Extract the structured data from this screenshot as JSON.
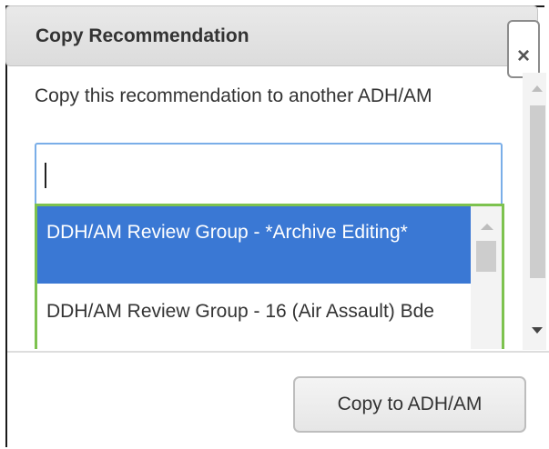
{
  "dialog": {
    "title": "Copy Recommendation",
    "close_glyph": "×",
    "prompt": "Copy this recommendation to another ADH/AM"
  },
  "search": {
    "value": "",
    "placeholder": ""
  },
  "dropdown": {
    "options": [
      {
        "label": "DDH/AM Review Group - *Archive Editing*",
        "selected": true
      },
      {
        "label": "DDH/AM Review Group - 16 (Air Assault) Bde",
        "selected": false
      }
    ]
  },
  "footer": {
    "copy_button_label": "Copy to ADH/AM"
  },
  "icons": {
    "close": "close-icon",
    "scroll_up": "chevron-up-icon",
    "scroll_down": "chevron-down-icon"
  },
  "colors": {
    "selected_option_bg": "#3a78d4",
    "dropdown_border": "#7dc24f",
    "input_focus_border": "#7aaee8",
    "title_bar_bg": "#e2e2e2"
  }
}
